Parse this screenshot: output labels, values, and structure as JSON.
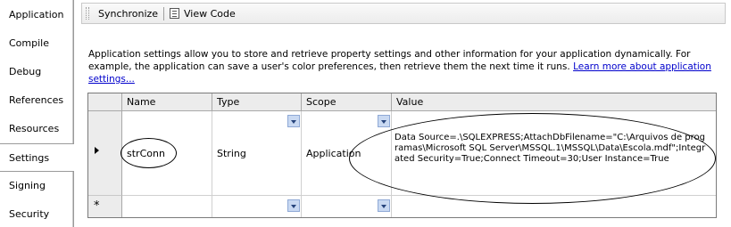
{
  "sidebar": {
    "tabs": [
      {
        "label": "Application",
        "selected": false
      },
      {
        "label": "Compile",
        "selected": false
      },
      {
        "label": "Debug",
        "selected": false
      },
      {
        "label": "References",
        "selected": false
      },
      {
        "label": "Resources",
        "selected": false
      },
      {
        "label": "Settings",
        "selected": true
      },
      {
        "label": "Signing",
        "selected": false
      },
      {
        "label": "Security",
        "selected": false
      }
    ]
  },
  "toolbar": {
    "synchronize_label": "Synchronize",
    "view_code_label": "View Code"
  },
  "description": {
    "text": "Application settings allow you to store and retrieve property settings and other information for your application dynamically. For example, the application can save a user's color preferences, then retrieve them the next time it runs.",
    "link": "Learn more about application settings..."
  },
  "grid": {
    "columns": [
      "Name",
      "Type",
      "Scope",
      "Value"
    ],
    "rows": [
      {
        "name": "strConn",
        "type": "String",
        "scope": "Application",
        "value": "Data Source=.\\SQLEXPRESS;AttachDbFilename=\"C:\\Arquivos de programas\\Microsoft SQL Server\\MSSQL.1\\MSSQL\\Data\\Escola.mdf\";Integrated Security=True;Connect Timeout=30;User Instance=True"
      }
    ],
    "new_row_marker": "*"
  }
}
